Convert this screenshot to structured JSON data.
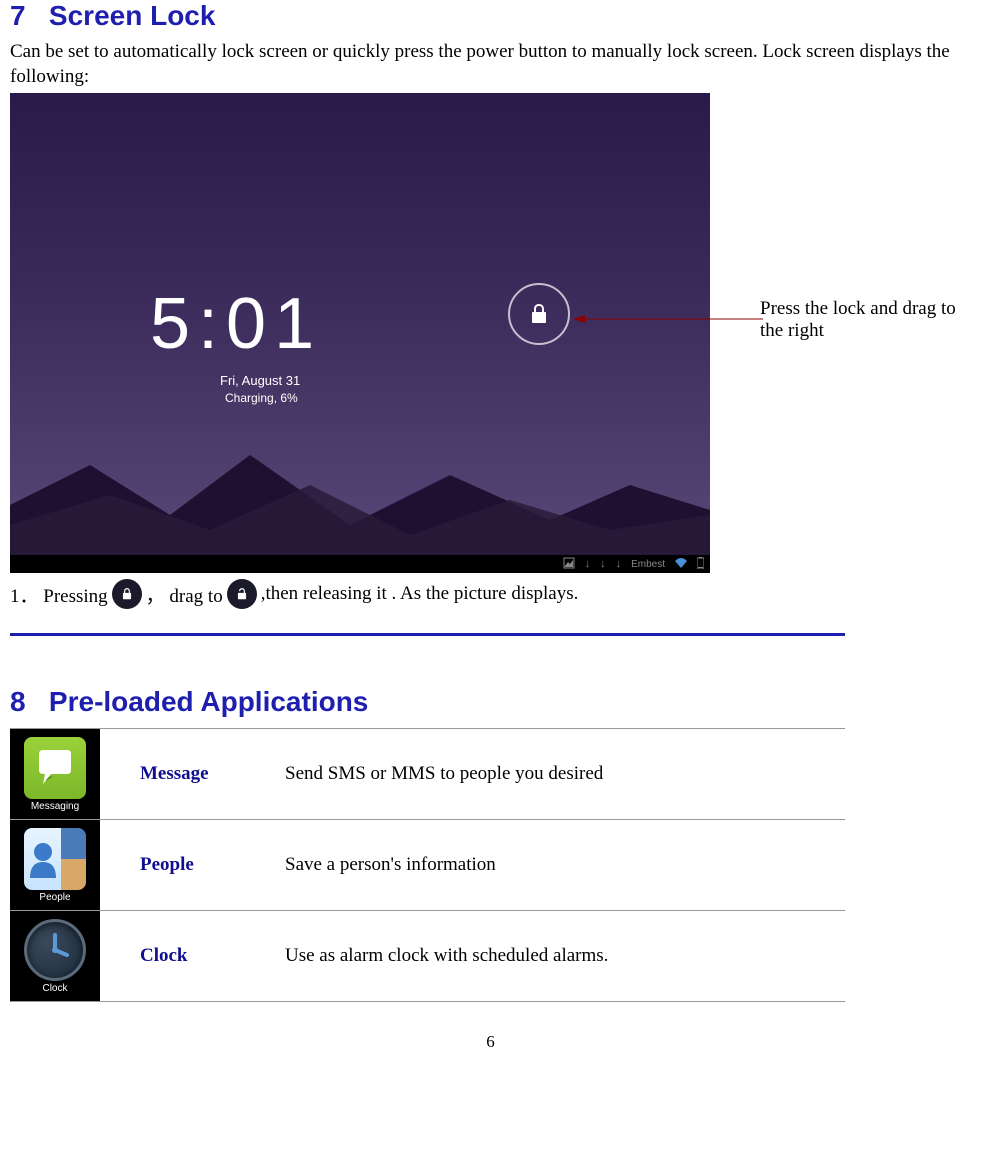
{
  "section7": {
    "number": "7",
    "title": "Screen Lock",
    "intro": "Can be set to automatically lock screen or quickly press the power button to manually lock screen. Lock screen displays the following:",
    "annotation": "Press the lock and drag to the right",
    "screenshot": {
      "time": "5:01",
      "date": "Fri, August 31",
      "charging": "Charging, 6%",
      "status_text": "Embest"
    },
    "step_prefix": "1．  Pressing ",
    "step_mid": "，  drag to ",
    "step_suffix": ",then releasing it . As the picture displays."
  },
  "section8": {
    "number": "8",
    "title": "Pre-loaded Applications",
    "apps": [
      {
        "name": "Message",
        "desc": "Send SMS or MMS to people you desired",
        "icon_label": "Messaging"
      },
      {
        "name": "People",
        "desc": "Save a person's information",
        "icon_label": "People"
      },
      {
        "name": "Clock",
        "desc": "Use as alarm clock with scheduled alarms.",
        "icon_label": "Clock"
      }
    ]
  },
  "page_number": "6"
}
